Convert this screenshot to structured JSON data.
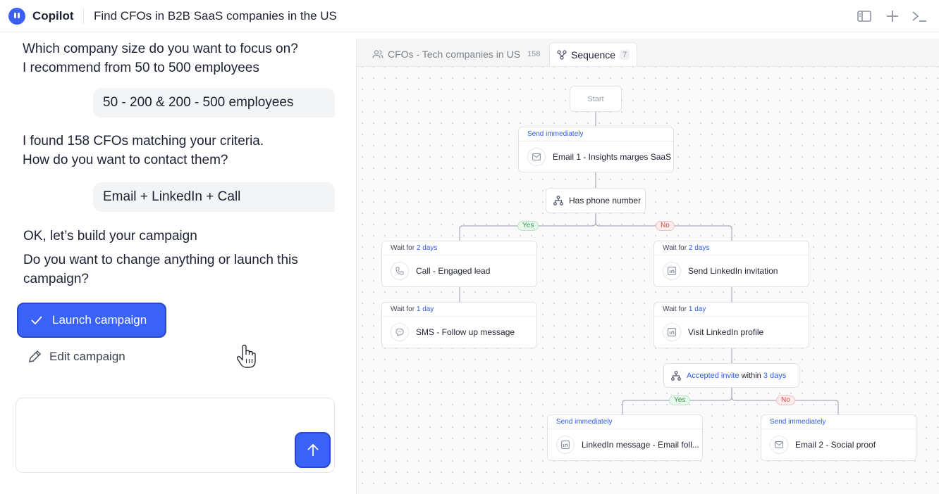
{
  "header": {
    "brand": "Copilot",
    "title": "Find CFOs in B2B SaaS companies in the US",
    "icons": [
      "sidebar-toggle-icon",
      "plus-icon",
      "terminal-icon"
    ]
  },
  "chat": {
    "q1_line1": "Which company size do you want to focus on?",
    "q1_line2": "I recommend from 50 to 500 employees",
    "a1": "50 - 200 & 200 - 500 employees",
    "q2_line1": "I found 158 CFOs matching your criteria.",
    "q2_line2": "How do you want to contact them?",
    "a2": "Email + LinkedIn + Call",
    "q3": "OK, let’s build your campaign",
    "q4_line1": "Do you want to change anything or launch this",
    "q4_line2": "campaign?",
    "launch_label": "Launch campaign",
    "edit_label": "Edit campaign",
    "composer_placeholder": ""
  },
  "tabs": {
    "list_label": "CFOs - Tech companies in US",
    "list_count": "158",
    "sequence_label": "Sequence",
    "sequence_count": "7"
  },
  "flow": {
    "start": "Start",
    "email1_timing": "Send immediately",
    "email1_label": "Email 1 - Insights marges SaaS",
    "cond1_label": "Has phone number",
    "yes": "Yes",
    "no": "No",
    "call_wait_prefix": "Wait for",
    "call_wait": "2 days",
    "call_label": "Call - Engaged lead",
    "sms_wait_prefix": "Wait for",
    "sms_wait": "1 day",
    "sms_label": "SMS - Follow up message",
    "li_inv_wait_prefix": "Wait for",
    "li_inv_wait": "2 days",
    "li_inv_label": "Send LinkedIn invitation",
    "li_visit_wait_prefix": "Wait for",
    "li_visit_wait": "1 day",
    "li_visit_label": "Visit LinkedIn profile",
    "cond2_prefix": "Accepted invite",
    "cond2_within": "within",
    "cond2_days": "3 days",
    "yes2": "Yes",
    "no2": "No",
    "li_msg_timing": "Send immediately",
    "li_msg_label": "LinkedIn message - Email foll...",
    "email2_timing": "Send immediately",
    "email2_label": "Email 2 - Social proof"
  },
  "colors": {
    "accent": "#3b62f6",
    "link_blue": "#2f5ce8",
    "yes_green": "#2e9b4a",
    "no_red": "#d24b4b"
  }
}
